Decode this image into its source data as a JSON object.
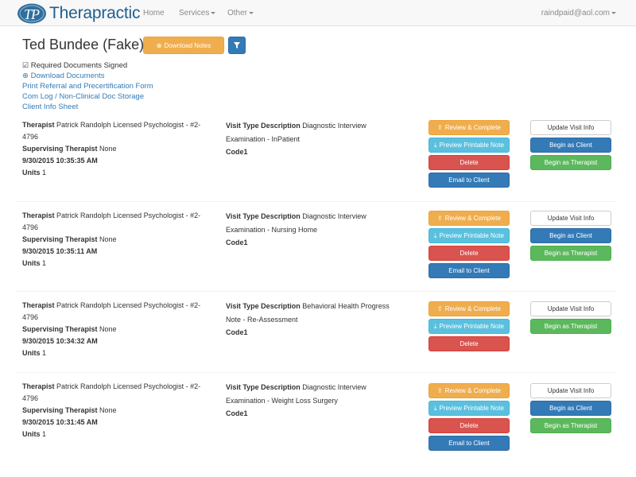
{
  "nav": {
    "brand": "Therapractic",
    "items": [
      {
        "label": "Home",
        "dropdown": false
      },
      {
        "label": "Services",
        "dropdown": true
      },
      {
        "label": "Other",
        "dropdown": true
      }
    ],
    "user": "raindpaid@aol.com"
  },
  "client": {
    "name": "Ted Bundee (Fake)",
    "download_notes_label": "Download Notes"
  },
  "links": {
    "required_docs": "Required Documents Signed",
    "download_documents": "Download Documents",
    "print_referral": "Print Referral and Precertification Form",
    "com_log": "Com Log / Non-Clinical Doc Storage",
    "client_info_sheet": "Client Info Sheet"
  },
  "labels": {
    "therapist": "Therapist",
    "supervising_therapist": "Supervising Therapist",
    "units": "Units",
    "visit_type_description": "Visit Type Description",
    "review_complete": "Review & Complete",
    "preview_printable": "Preview Printable Note",
    "delete": "Delete",
    "email_client": "Email to Client",
    "update_visit": "Update Visit Info",
    "begin_client": "Begin as Client",
    "begin_therapist": "Begin as Therapist"
  },
  "visits": [
    {
      "therapist_line1": "Patrick Randolph Licensed Psychologist - #2-",
      "therapist_line2": "4796",
      "supervising": "None",
      "datetime": "9/30/2015 10:35:35 AM",
      "units": "1",
      "visit_type_line1": "Diagnostic Interview",
      "visit_type_line2": "Examination - InPatient",
      "code": "Code1"
    },
    {
      "therapist_line1": "Patrick Randolph Licensed Psychologist - #2-",
      "therapist_line2": "4796",
      "supervising": "None",
      "datetime": "9/30/2015 10:35:11 AM",
      "units": "1",
      "visit_type_line1": "Diagnostic Interview",
      "visit_type_line2": "Examination - Nursing Home",
      "code": "Code1"
    },
    {
      "therapist_line1": "Patrick Randolph Licensed Psychologist - #2-",
      "therapist_line2": "4796",
      "supervising": "None",
      "datetime": "9/30/2015 10:34:32 AM",
      "units": "1",
      "visit_type_line1": "Behavioral Health Progress",
      "visit_type_line2": "Note - Re-Assessment",
      "code": "Code1"
    },
    {
      "therapist_line1": "Patrick Randolph Licensed Psychologist - #2-",
      "therapist_line2": "4796",
      "supervising": "None",
      "datetime": "9/30/2015 10:31:45 AM",
      "units": "1",
      "visit_type_line1": "Diagnostic Interview",
      "visit_type_line2": "Examination - Weight Loss Surgery",
      "code": "Code1"
    }
  ],
  "colors": {
    "warning": "#f0ad4e",
    "info": "#5bc0de",
    "danger": "#d9534f",
    "primary": "#337ab7",
    "success": "#5cb85c",
    "brand": "#1f5f8e"
  },
  "icons": {
    "download": "download-circle-icon",
    "filter": "filter-icon",
    "check": "checkbox-check-icon",
    "upload": "upload-icon"
  }
}
